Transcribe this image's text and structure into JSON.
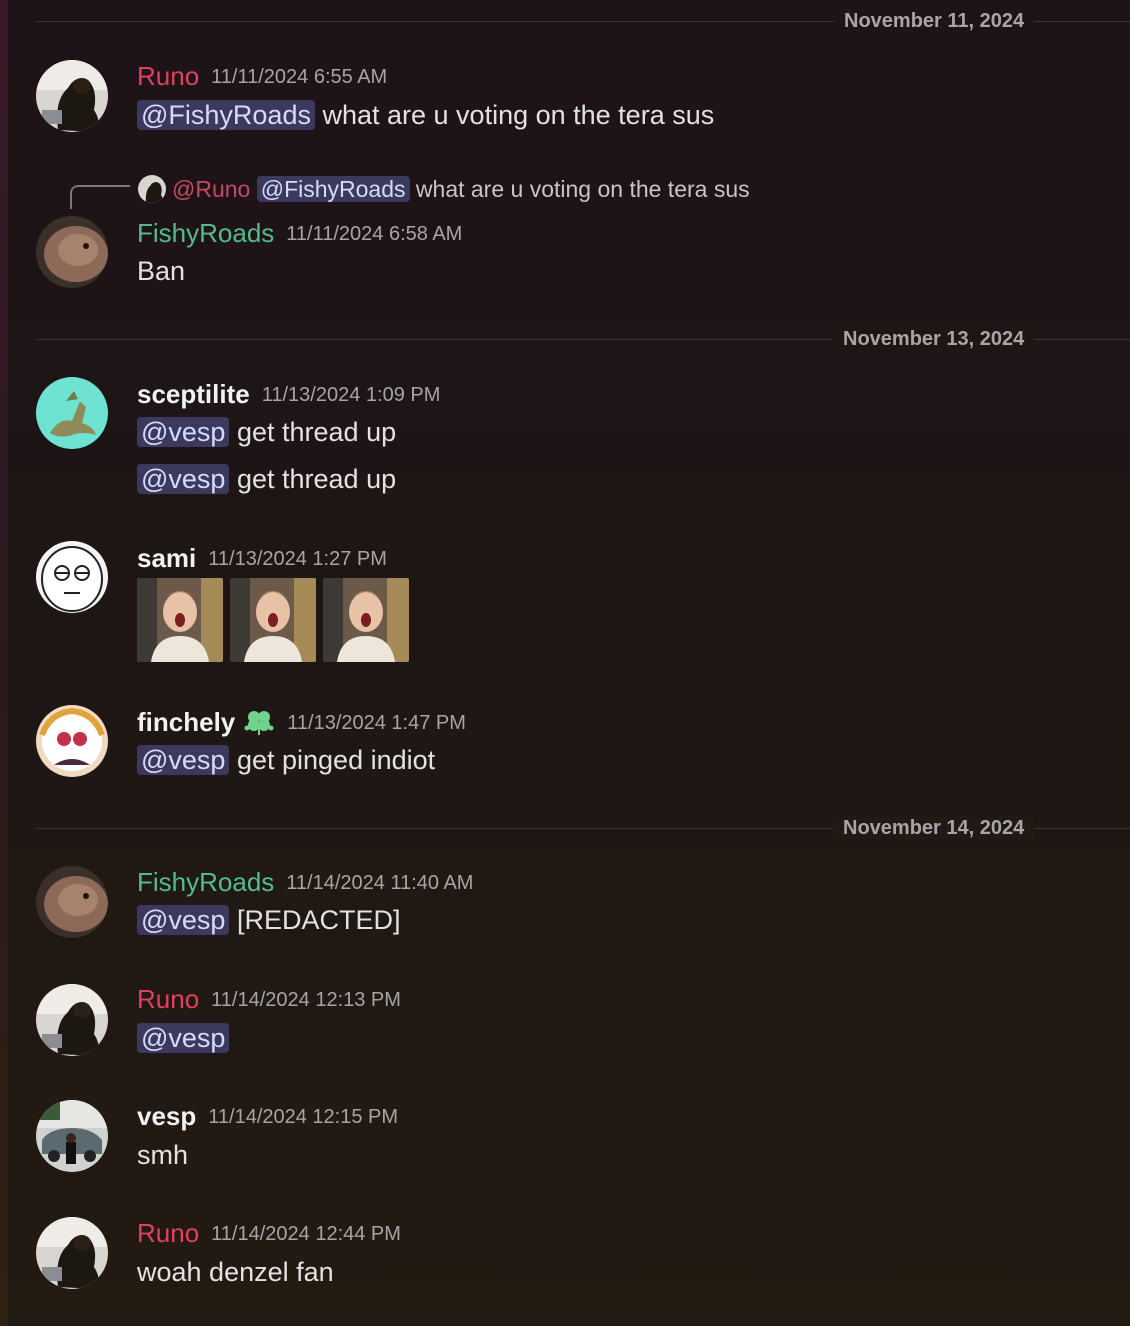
{
  "dividers": [
    "November 11, 2024",
    "November 13, 2024",
    "November 14, 2024"
  ],
  "messages": [
    {
      "author": "Runo",
      "timestamp": "11/11/2024 6:55 AM",
      "mention": "@FishyRoads",
      "text": "what are u voting on the tera sus"
    },
    {
      "reply": {
        "author": "@Runo",
        "mention": "@FishyRoads",
        "text": "what are u voting on the tera sus"
      },
      "author": "FishyRoads",
      "timestamp": "11/11/2024 6:58 AM",
      "text": "Ban"
    },
    {
      "author": "sceptilite",
      "timestamp": "11/13/2024 1:09 PM",
      "lines": [
        {
          "mention": "@vesp",
          "text": "get thread up"
        },
        {
          "mention": "@vesp",
          "text": "get thread up"
        }
      ]
    },
    {
      "author": "sami",
      "timestamp": "11/13/2024 1:27 PM",
      "attachments": [
        "shocked-kid-image",
        "shocked-kid-image",
        "shocked-kid-image"
      ]
    },
    {
      "author": "finchely",
      "timestamp": "11/13/2024 1:47 PM",
      "badge": "clover-icon",
      "mention": "@vesp",
      "text": "get pinged indiot"
    },
    {
      "author": "FishyRoads",
      "timestamp": "11/14/2024 11:40 AM",
      "mention": "@vesp",
      "text": "[REDACTED]"
    },
    {
      "author": "Runo",
      "timestamp": "11/14/2024 12:13 PM",
      "mention": "@vesp"
    },
    {
      "author": "vesp",
      "timestamp": "11/14/2024 12:15 PM",
      "text": "smh"
    },
    {
      "author": "Runo",
      "timestamp": "11/14/2024 12:44 PM",
      "text": "woah denzel fan"
    }
  ],
  "colors": {
    "runo": "#e23f62",
    "fishyroads": "#52bd8a",
    "mention_bg": "#3b3a5e",
    "mention_text": "#d7dafc"
  }
}
